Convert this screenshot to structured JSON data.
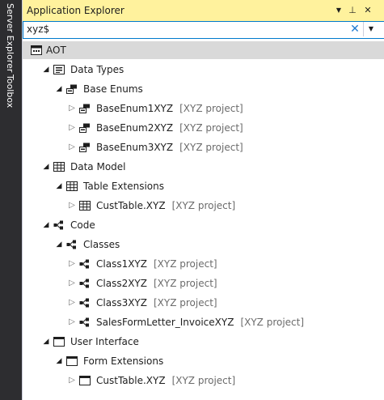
{
  "side_tabs": [
    "Server Explorer",
    "Toolbox"
  ],
  "panel": {
    "title": "Application Explorer",
    "buttons": {
      "dropdown": "▼",
      "pin": "⊥",
      "close": "✕"
    }
  },
  "search": {
    "value": "xyz$",
    "clear": "✕",
    "dropdown": "▼"
  },
  "tree": {
    "root": "AOT",
    "nodes": [
      {
        "label": "Data Types",
        "project": ""
      },
      {
        "label": "Base Enums",
        "project": ""
      },
      {
        "label": "BaseEnum1XYZ",
        "project": "[XYZ project]"
      },
      {
        "label": "BaseEnum2XYZ",
        "project": "[XYZ project]"
      },
      {
        "label": "BaseEnum3XYZ",
        "project": "[XYZ project]"
      },
      {
        "label": "Data Model",
        "project": ""
      },
      {
        "label": "Table Extensions",
        "project": ""
      },
      {
        "label": "CustTable.XYZ",
        "project": "[XYZ project]"
      },
      {
        "label": "Code",
        "project": ""
      },
      {
        "label": "Classes",
        "project": ""
      },
      {
        "label": "Class1XYZ",
        "project": "[XYZ project]"
      },
      {
        "label": "Class2XYZ",
        "project": "[XYZ project]"
      },
      {
        "label": "Class3XYZ",
        "project": "[XYZ project]"
      },
      {
        "label": "SalesFormLetter_InvoiceXYZ",
        "project": "[XYZ project]"
      },
      {
        "label": "User Interface",
        "project": ""
      },
      {
        "label": "Form Extensions",
        "project": ""
      },
      {
        "label": "CustTable.XYZ",
        "project": "[XYZ project]"
      }
    ]
  },
  "colors": {
    "titlebar": "#fff29d",
    "accent": "#007acc",
    "selected": "#d9d9d9",
    "chrome": "#2d2d30"
  }
}
